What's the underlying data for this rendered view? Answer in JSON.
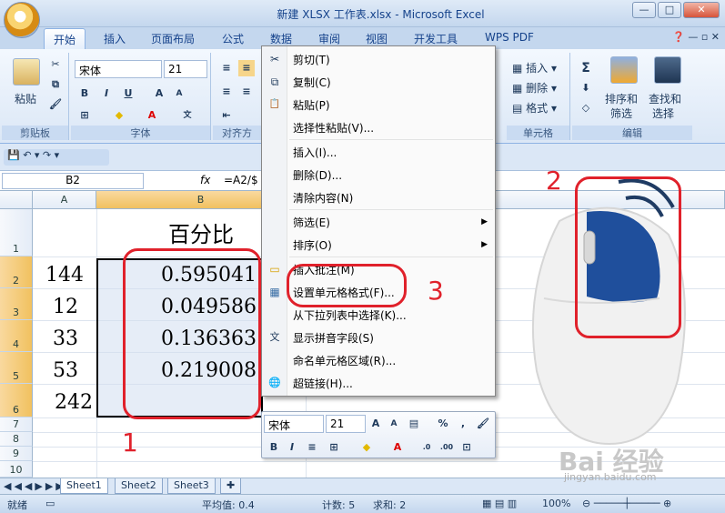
{
  "window": {
    "title": "新建 XLSX 工作表.xlsx - Microsoft Excel",
    "min": "—",
    "max": "□",
    "close": "✕"
  },
  "ribbon_tabs": [
    "开始",
    "插入",
    "页面布局",
    "公式",
    "数据",
    "审阅",
    "视图",
    "开发工具",
    "WPS PDF"
  ],
  "ribbon": {
    "paste_label": "粘贴",
    "clipboard_group": "剪贴板",
    "font_group": "字体",
    "align_group": "对齐方",
    "cells_group": "单元格",
    "edit_group": "编辑",
    "font_name": "宋体",
    "font_size": "21",
    "insert": "插入",
    "delete": "删除",
    "format": "格式",
    "sort_filter_1": "排序和",
    "sort_filter_2": "筛选",
    "find_select_1": "查找和",
    "find_select_2": "选择"
  },
  "formula_bar": {
    "name_box": "B2",
    "fx": "fx",
    "formula": "=A2/$"
  },
  "columns": [
    "A",
    "B"
  ],
  "rows": [
    "1",
    "2",
    "3",
    "4",
    "5",
    "6",
    "7",
    "8",
    "9",
    "10"
  ],
  "cells": {
    "B1": "百分比",
    "A": [
      "144",
      "12",
      "33",
      "53",
      "242"
    ],
    "B": [
      "0.595041",
      "0.049586",
      "0.136363",
      "0.219008"
    ]
  },
  "context_menu": {
    "items": [
      {
        "label": "剪切(T)",
        "icon": "scissors-icon",
        "glyph": "✂"
      },
      {
        "label": "复制(C)",
        "icon": "copy-icon",
        "glyph": "⧉"
      },
      {
        "label": "粘贴(P)",
        "icon": "paste-icon",
        "glyph": "📋"
      },
      {
        "label": "选择性粘贴(V)...",
        "icon": "",
        "glyph": ""
      },
      {
        "label": "插入(I)...",
        "icon": "",
        "glyph": ""
      },
      {
        "label": "删除(D)...",
        "icon": "",
        "glyph": ""
      },
      {
        "label": "清除内容(N)",
        "icon": "",
        "glyph": ""
      },
      {
        "label": "筛选(E)",
        "icon": "",
        "glyph": ""
      },
      {
        "label": "排序(O)",
        "icon": "",
        "glyph": ""
      },
      {
        "label": "插入批注(M)",
        "icon": "comment-icon",
        "glyph": "▭"
      },
      {
        "label": "设置单元格格式(F)...",
        "icon": "format-cells-icon",
        "glyph": "▦"
      },
      {
        "label": "从下拉列表中选择(K)...",
        "icon": "",
        "glyph": ""
      },
      {
        "label": "显示拼音字段(S)",
        "icon": "pinyin-icon",
        "glyph": "文"
      },
      {
        "label": "命名单元格区域(R)...",
        "icon": "",
        "glyph": ""
      },
      {
        "label": "超链接(H)...",
        "icon": "hyperlink-icon",
        "glyph": "🌐"
      }
    ]
  },
  "mini_toolbar": {
    "font_name": "宋体",
    "font_size": "21",
    "percent": "%",
    "comma": ","
  },
  "sheets": [
    "Sheet1",
    "Sheet2",
    "Sheet3"
  ],
  "status": {
    "ready": "就绪",
    "average": "平均值: 0.4",
    "count": "计数: 5",
    "sum": "求和: 2",
    "zoom": "100%"
  },
  "annotations": [
    "1",
    "2",
    "3"
  ],
  "watermark": {
    "logo": "Bai 经验",
    "url": "jingyan.baidu.com"
  },
  "colors": {
    "ribbon_blue": "#c4d7ee",
    "annotation_red": "#e0212b",
    "mouse_button_blue": "#1f4f9c"
  }
}
